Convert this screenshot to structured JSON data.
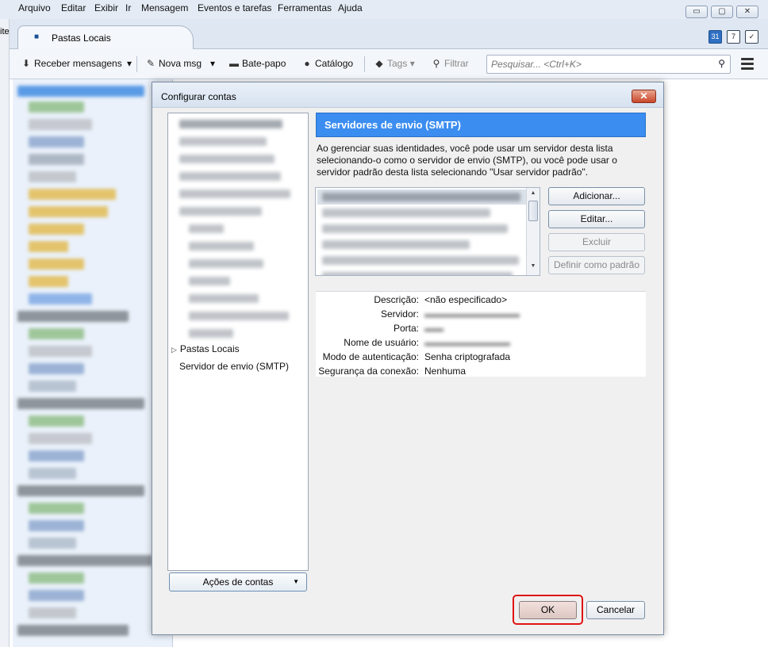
{
  "menu": [
    "Arquivo",
    "Editar",
    "Exibir",
    "Ir",
    "Mensagem",
    "Eventos e tarefas",
    "Ferramentas",
    "Ajuda"
  ],
  "window_controls": {
    "minimize": "▭",
    "restore": "▢",
    "close": "✕"
  },
  "left_edge_text": "ite",
  "tab": {
    "label": "Pastas Locais",
    "icon": "monitor-icon"
  },
  "tab_icons": {
    "calendar": "31",
    "tasks": "7"
  },
  "toolbar": {
    "receive": "Receber mensagens",
    "new_msg": "Nova msg",
    "chat": "Bate-papo",
    "catalog": "Catálogo",
    "tags": "Tags",
    "filter": "Filtrar",
    "search_placeholder": "Pesquisar... <Ctrl+K>"
  },
  "dialog": {
    "title": "Configurar contas",
    "close": "✕",
    "tree": {
      "local_folders": "Pastas Locais",
      "smtp": "Servidor de envio (SMTP)"
    },
    "account_actions": "Ações de contas",
    "header": "Servidores de envio (SMTP)",
    "description": "Ao gerenciar suas identidades, você pode usar um servidor desta lista selecionando-o como o servidor de envio (SMTP), ou você pode usar o servidor padrão desta lista selecionando \"Usar servidor padrão\".",
    "buttons": {
      "add": "Adicionar...",
      "edit": "Editar...",
      "delete": "Excluir",
      "set_default": "Definir como padrão"
    },
    "details": {
      "labels": [
        "Descrição:",
        "Servidor:",
        "Porta:",
        "Nome de usuário:",
        "Modo de autenticação:",
        "Segurança da conexão:"
      ],
      "description_value": "<não especificado>",
      "auth_value": "Senha criptografada",
      "security_value": "Nenhuma"
    },
    "ok": "OK",
    "cancel": "Cancelar"
  },
  "colors": {
    "header_blue": "#3b8df0",
    "highlight_red": "#e01313"
  }
}
